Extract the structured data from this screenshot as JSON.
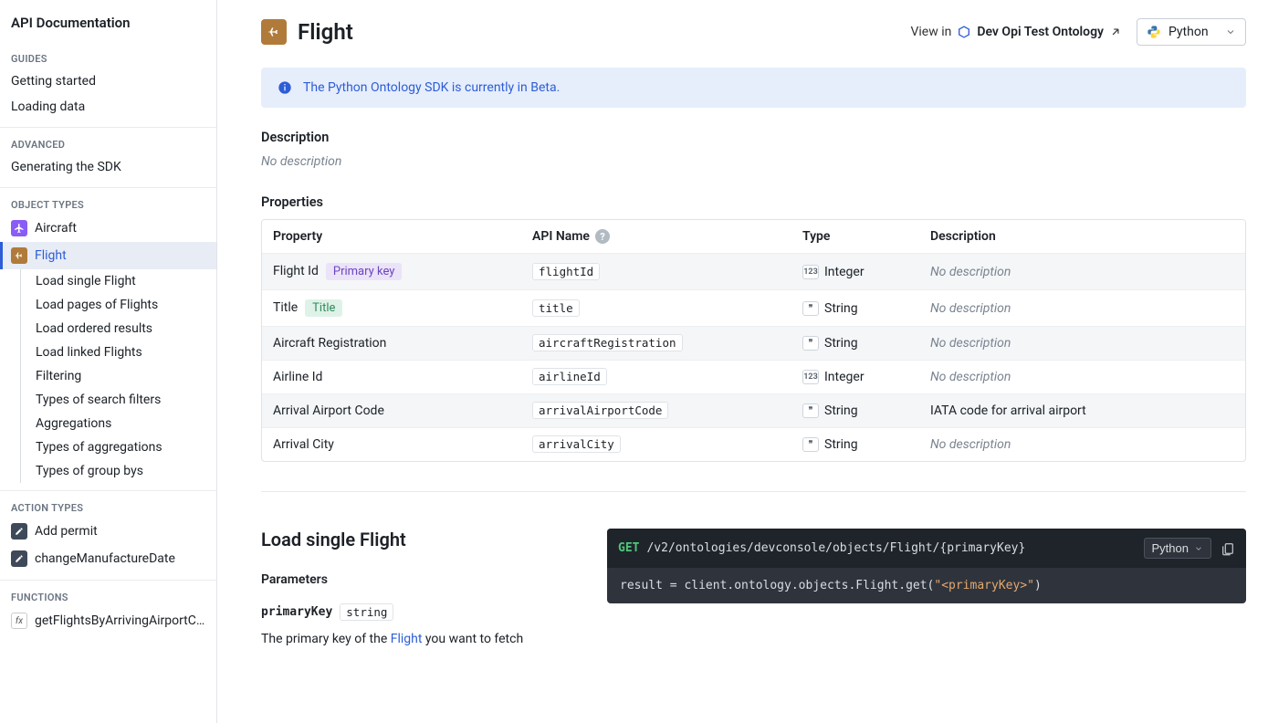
{
  "sidebar": {
    "title": "API Documentation",
    "sections": {
      "guides": {
        "header": "GUIDES",
        "items": [
          "Getting started",
          "Loading data"
        ]
      },
      "advanced": {
        "header": "ADVANCED",
        "items": [
          "Generating the SDK"
        ]
      },
      "object_types": {
        "header": "OBJECT TYPES",
        "items": [
          {
            "label": "Aircraft"
          },
          {
            "label": "Flight",
            "active": true,
            "children": [
              "Load single Flight",
              "Load pages of Flights",
              "Load ordered results",
              "Load linked Flights",
              "Filtering",
              "Types of search filters",
              "Aggregations",
              "Types of aggregations",
              "Types of group bys"
            ]
          }
        ]
      },
      "action_types": {
        "header": "ACTION TYPES",
        "items": [
          "Add permit",
          "changeManufactureDate"
        ]
      },
      "functions": {
        "header": "FUNCTIONS",
        "items": [
          "getFlightsByArrivingAirportC…"
        ]
      }
    }
  },
  "header": {
    "title": "Flight",
    "view_in_label": "View in",
    "ontology_name": "Dev Opi Test Ontology",
    "language": "Python"
  },
  "banner": {
    "message": "The Python Ontology SDK is currently in Beta."
  },
  "description": {
    "heading": "Description",
    "text": "No description"
  },
  "properties": {
    "heading": "Properties",
    "columns": {
      "property": "Property",
      "api_name": "API Name",
      "type": "Type",
      "description": "Description"
    },
    "rows": [
      {
        "name": "Flight Id",
        "badge": "Primary key",
        "badge_kind": "primary",
        "api": "flightId",
        "type": "Integer",
        "type_icon": "123",
        "desc": "No description",
        "muted": true
      },
      {
        "name": "Title",
        "badge": "Title",
        "badge_kind": "title",
        "api": "title",
        "type": "String",
        "type_icon": "❞",
        "desc": "No description",
        "muted": true
      },
      {
        "name": "Aircraft Registration",
        "api": "aircraftRegistration",
        "type": "String",
        "type_icon": "❞",
        "desc": "No description",
        "muted": true
      },
      {
        "name": "Airline Id",
        "api": "airlineId",
        "type": "Integer",
        "type_icon": "123",
        "desc": "No description",
        "muted": true
      },
      {
        "name": "Arrival Airport Code",
        "api": "arrivalAirportCode",
        "type": "String",
        "type_icon": "❞",
        "desc": "IATA code for arrival airport",
        "muted": false
      },
      {
        "name": "Arrival City",
        "api": "arrivalCity",
        "type": "String",
        "type_icon": "❞",
        "desc": "No description",
        "muted": true
      }
    ]
  },
  "load_single": {
    "heading": "Load single Flight",
    "parameters_heading": "Parameters",
    "param_name": "primaryKey",
    "param_type": "string",
    "param_desc_prefix": "The primary key of the ",
    "param_desc_link": "Flight",
    "param_desc_suffix": " you want to fetch",
    "code": {
      "method": "GET",
      "path": "/v2/ontologies/devconsole/objects/Flight/{primaryKey}",
      "lang": "Python",
      "body_prefix": "result = client.ontology.objects.Flight.get(",
      "body_str": "\"<primaryKey>\"",
      "body_suffix": ")"
    }
  }
}
